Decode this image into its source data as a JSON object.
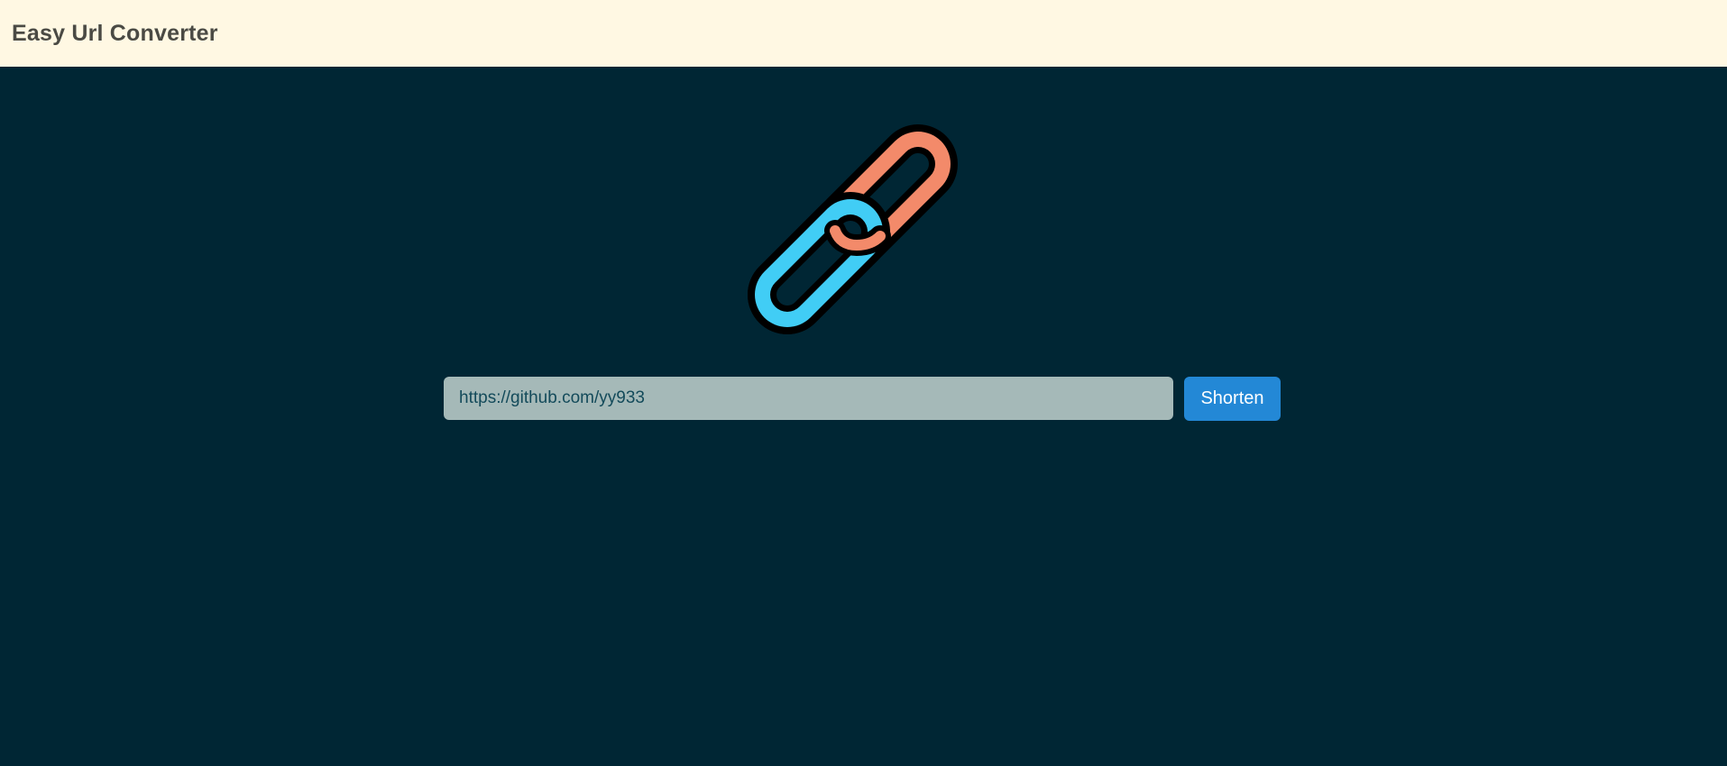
{
  "navbar": {
    "brand": "Easy Url Converter"
  },
  "logo": {
    "icon": "chain-link-icon",
    "colors": {
      "link_front": "#41CDF5",
      "link_back": "#F38A6A",
      "outline": "#000000"
    }
  },
  "form": {
    "url_value": "https://github.com/yy933",
    "url_placeholder": "",
    "submit_label": "Shorten"
  },
  "theme": {
    "background": "#002634",
    "navbar_background": "#FFF8E3",
    "input_background": "#A5B9B8",
    "button_background": "#2388D6"
  }
}
